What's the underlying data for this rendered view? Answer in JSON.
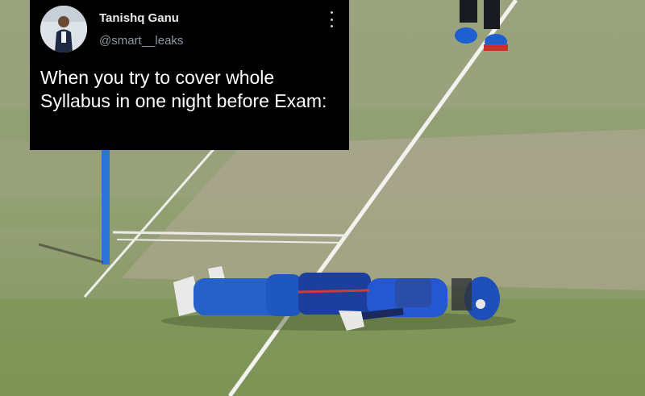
{
  "tweet": {
    "display_name": "Tanishq Ganu",
    "handle": "@smart__leaks",
    "text": "When you try to cover whole Syllabus in one night before Exam:"
  },
  "icons": {
    "menu": "more-vertical-icon",
    "avatar": "profile-photo"
  },
  "colors": {
    "card_background": "#000000",
    "name_text": "#e7e9ea",
    "handle_text": "#8b98a5",
    "jersey_blue": "#1c3f9e",
    "helmet_blue": "#1e4fb8",
    "stump_blue": "#2a74d6"
  }
}
